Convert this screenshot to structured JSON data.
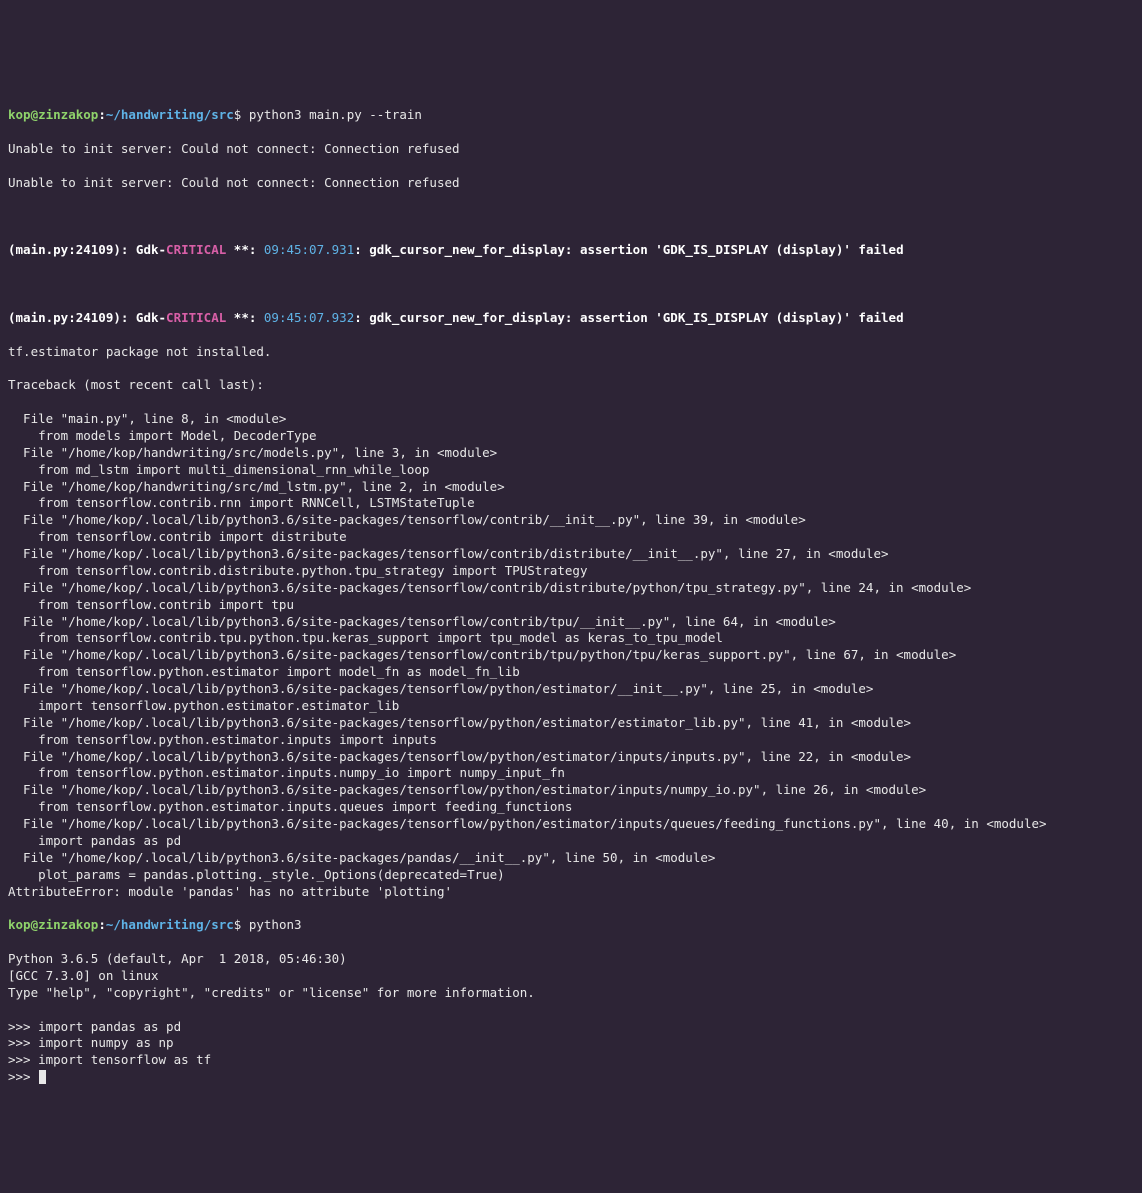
{
  "prompt1": {
    "user": "kop",
    "at": "@",
    "host": "zinzakop",
    "colon": ":",
    "path": "~/handwriting/src",
    "dollar": "$ ",
    "command": "python3 main.py --train"
  },
  "err1": "Unable to init server: Could not connect: Connection refused",
  "err2": "Unable to init server: Could not connect: Connection refused",
  "gdk1": {
    "prefix": "(main.py:24109): Gdk-",
    "critical": "CRITICAL",
    "stars": " **: ",
    "ts": "09:45:07.931",
    "rest": ": gdk_cursor_new_for_display: assertion 'GDK_IS_DISPLAY (display)' failed"
  },
  "gdk2": {
    "prefix": "(main.py:24109): Gdk-",
    "critical": "CRITICAL",
    "stars": " **: ",
    "ts": "09:45:07.932",
    "rest": ": gdk_cursor_new_for_display: assertion 'GDK_IS_DISPLAY (display)' failed"
  },
  "tfmsg": "tf.estimator package not installed.",
  "tbhead": "Traceback (most recent call last):",
  "tb": [
    "  File \"main.py\", line 8, in <module>",
    "    from models import Model, DecoderType",
    "  File \"/home/kop/handwriting/src/models.py\", line 3, in <module>",
    "    from md_lstm import multi_dimensional_rnn_while_loop",
    "  File \"/home/kop/handwriting/src/md_lstm.py\", line 2, in <module>",
    "    from tensorflow.contrib.rnn import RNNCell, LSTMStateTuple",
    "  File \"/home/kop/.local/lib/python3.6/site-packages/tensorflow/contrib/__init__.py\", line 39, in <module>",
    "    from tensorflow.contrib import distribute",
    "  File \"/home/kop/.local/lib/python3.6/site-packages/tensorflow/contrib/distribute/__init__.py\", line 27, in <module>",
    "    from tensorflow.contrib.distribute.python.tpu_strategy import TPUStrategy",
    "  File \"/home/kop/.local/lib/python3.6/site-packages/tensorflow/contrib/distribute/python/tpu_strategy.py\", line 24, in <module>",
    "    from tensorflow.contrib import tpu",
    "  File \"/home/kop/.local/lib/python3.6/site-packages/tensorflow/contrib/tpu/__init__.py\", line 64, in <module>",
    "    from tensorflow.contrib.tpu.python.tpu.keras_support import tpu_model as keras_to_tpu_model",
    "  File \"/home/kop/.local/lib/python3.6/site-packages/tensorflow/contrib/tpu/python/tpu/keras_support.py\", line 67, in <module>",
    "    from tensorflow.python.estimator import model_fn as model_fn_lib",
    "  File \"/home/kop/.local/lib/python3.6/site-packages/tensorflow/python/estimator/__init__.py\", line 25, in <module>",
    "    import tensorflow.python.estimator.estimator_lib",
    "  File \"/home/kop/.local/lib/python3.6/site-packages/tensorflow/python/estimator/estimator_lib.py\", line 41, in <module>",
    "    from tensorflow.python.estimator.inputs import inputs",
    "  File \"/home/kop/.local/lib/python3.6/site-packages/tensorflow/python/estimator/inputs/inputs.py\", line 22, in <module>",
    "    from tensorflow.python.estimator.inputs.numpy_io import numpy_input_fn",
    "  File \"/home/kop/.local/lib/python3.6/site-packages/tensorflow/python/estimator/inputs/numpy_io.py\", line 26, in <module>",
    "    from tensorflow.python.estimator.inputs.queues import feeding_functions",
    "  File \"/home/kop/.local/lib/python3.6/site-packages/tensorflow/python/estimator/inputs/queues/feeding_functions.py\", line 40, in <module>",
    "    import pandas as pd",
    "  File \"/home/kop/.local/lib/python3.6/site-packages/pandas/__init__.py\", line 50, in <module>",
    "    plot_params = pandas.plotting._style._Options(deprecated=True)",
    "AttributeError: module 'pandas' has no attribute 'plotting'"
  ],
  "prompt2": {
    "user": "kop",
    "at": "@",
    "host": "zinzakop",
    "colon": ":",
    "path": "~/handwriting/src",
    "dollar": "$ ",
    "command": "python3"
  },
  "pybanner": [
    "Python 3.6.5 (default, Apr  1 2018, 05:46:30)",
    "[GCC 7.3.0] on linux",
    "Type \"help\", \"copyright\", \"credits\" or \"license\" for more information."
  ],
  "repl": [
    {
      "prompt": ">>> ",
      "code": "import pandas as pd"
    },
    {
      "prompt": ">>> ",
      "code": "import numpy as np"
    },
    {
      "prompt": ">>> ",
      "code": "import tensorflow as tf"
    },
    {
      "prompt": ">>> ",
      "code": ""
    }
  ]
}
